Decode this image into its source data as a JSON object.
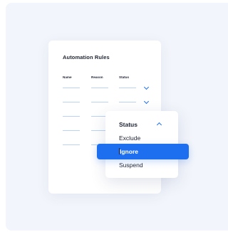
{
  "rules_card": {
    "title": "Automation Rules",
    "columns": [
      "Name",
      "Reason",
      "Status"
    ]
  },
  "status_dropdown": {
    "header": "Status",
    "options": [
      "Exclude",
      "Ignore",
      "Suspend"
    ],
    "selected": "Ignore"
  },
  "colors": {
    "accent": "#1e6ff0",
    "background_panel": "#f2f5fb",
    "placeholder_line": "#b9d2f5",
    "text": "#1f2433"
  }
}
